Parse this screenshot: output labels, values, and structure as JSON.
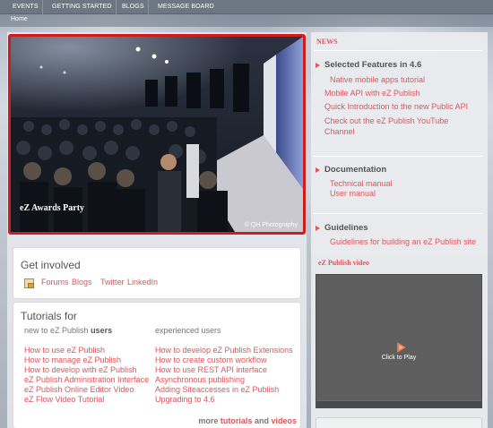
{
  "nav": {
    "items": [
      "EVENTS",
      "GETTING STARTED",
      "BLOGS",
      "MESSAGE BOARD"
    ]
  },
  "breadcrumb": "Home",
  "hero": {
    "caption": "eZ Awards Party",
    "credit": "© QH Photography"
  },
  "involved": {
    "title": "Get involved",
    "links": [
      "Forums",
      "Blogs",
      "Twitter",
      "LinkedIn"
    ]
  },
  "tutorials": {
    "title": "Tutorials for",
    "new_head_prefix": "new to eZ Publish",
    "new_head_bold": "users",
    "exp_head": "experienced users",
    "new_links": [
      "How to use eZ Publish",
      "How to manage eZ Publish",
      "How to develop with eZ Publish",
      "eZ Publish Administration Interface",
      "eZ Publish Online Editor Video",
      "eZ Flow Video Tutorial"
    ],
    "exp_links": [
      "How to develop eZ Publish Extensions",
      "How to create custom workflow",
      "How to use REST API interface",
      "Asynchronous publishing",
      "Adding Siteaccesses in eZ Publish",
      "Upgrading to 4.6"
    ],
    "more_prefix": "more",
    "more_tutorials": "tutorials",
    "more_and": "and",
    "more_videos": "videos"
  },
  "news": {
    "heading": "NEWS",
    "sections": [
      {
        "title": "Selected Features in 4.6",
        "links": [
          "Native mobile apps tutorial",
          "Mobile API with eZ Publish",
          "Quick Introduction to the new Public API",
          "Check out the eZ Publish YouTube",
          "Channel"
        ]
      },
      {
        "title": "Documentation",
        "links": [
          "Technical manual",
          "User manual"
        ]
      },
      {
        "title": "Guidelines",
        "links": [
          "Guidelines for building an eZ Publish site"
        ]
      }
    ]
  },
  "video": {
    "heading": "eZ Publish video",
    "play_label": "Click to Play"
  },
  "colors": {
    "accent": "#d9575c",
    "hero_border": "#d11c1c",
    "nav_bg": "#6d7784"
  }
}
